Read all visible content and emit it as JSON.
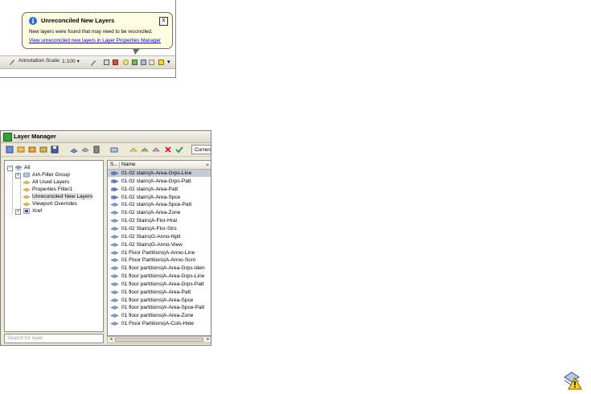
{
  "balloon": {
    "title": "Unreconciled New Layers",
    "message": "New layers were found that may need to be reconciled.",
    "link": "View unreconciled new layers in Layer Properties Manager",
    "close_label": "x"
  },
  "statusbar": {
    "annotation_label": "Annotation Scale:",
    "scale_value": "1:100 ▾",
    "overflow_arrow": "▾"
  },
  "layer_manager": {
    "title": "Layer Manager",
    "current_button": "Current",
    "search_placeholder": "Search for layer",
    "tree": [
      {
        "label": "All"
      },
      {
        "label": "AIA Filter Group"
      },
      {
        "label": "All Used Layers"
      },
      {
        "label": "Properties Filter1"
      },
      {
        "label": "Unreconciled New Layers"
      },
      {
        "label": "Viewport Overrides"
      },
      {
        "label": "Xref"
      }
    ],
    "columns": {
      "status": "S...",
      "name": "Name"
    },
    "layers": [
      "01-02 stairs|A-Area-Grps-Line",
      "01-02 stairs|A-Area-Grps-Patt",
      "01-02 stairs|A-Area-Patt",
      "01-02 stairs|A-Area-Spce",
      "01-02 stairs|A-Area-Spce-Patt",
      "01-02 stairs|A-Area-Zone",
      "01-02 Stairs|A-Flor-Hral",
      "01-02 Stairs|A-Flor-Strs",
      "01-02 Stairs|G-Anno-Nplt",
      "01-02 Stairs|G-Anno-View",
      "01 Floor Partitions|A-Anno-Line",
      "01 Floor Partitions|A-Anno-Scrn",
      "01 floor partitions|A-Area-Grps-Iden",
      "01 floor partitions|A-Area-Grps-Line",
      "01 floor partitions|A-Area-Grps-Patt",
      "01 floor partitions|A-Area-Patt",
      "01 floor partitions|A-Area-Spce",
      "01 floor partitions|A-Area-Spce-Patt",
      "01 floor partitions|A-Area-Zone",
      "01 Floor Partitions|A-Cols-Hide"
    ]
  },
  "colors": {
    "balloon_bg": "#fffde1",
    "link": "#0000cc",
    "selection": "#c5ccd8",
    "window_bg": "#ece9d8"
  }
}
